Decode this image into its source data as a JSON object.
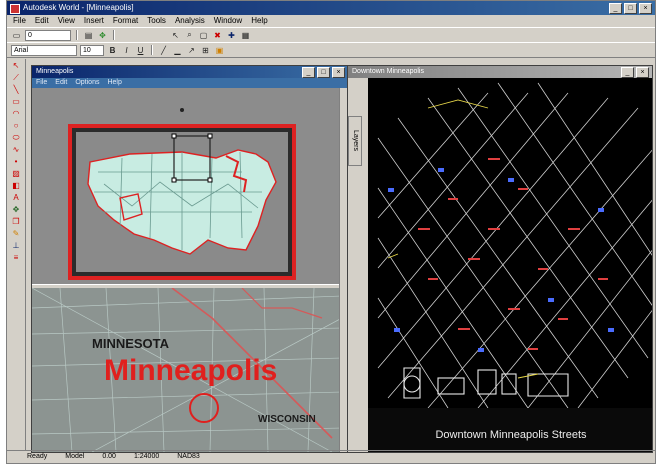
{
  "app": {
    "title": "Autodesk World - [Minneapolis]"
  },
  "menu": [
    "File",
    "Edit",
    "View",
    "Insert",
    "Format",
    "Tools",
    "Analysis",
    "Window",
    "Help"
  ],
  "toolbar": {
    "layer_combo": "0",
    "font_combo": "Arial",
    "size_combo": "10"
  },
  "map_window": {
    "title": "Minneapolis",
    "menu": [
      "File",
      "Edit",
      "Options",
      "Help"
    ],
    "labels": {
      "state": "MINNESOTA",
      "city": "Minneapolis",
      "neighbor_state": "WISCONSIN"
    }
  },
  "drawing_window": {
    "title": "Downtown Minneapolis",
    "side_tab": "Layers",
    "caption": "Downtown Minneapolis Streets"
  },
  "statusbar": [
    "Ready",
    "Model",
    "0.00",
    "1:24000",
    "NAD83"
  ],
  "colors": {
    "accent": "#0a246a",
    "map_red": "#e0201e",
    "cad_bg": "#000000",
    "frame": "#d4d0c8"
  }
}
